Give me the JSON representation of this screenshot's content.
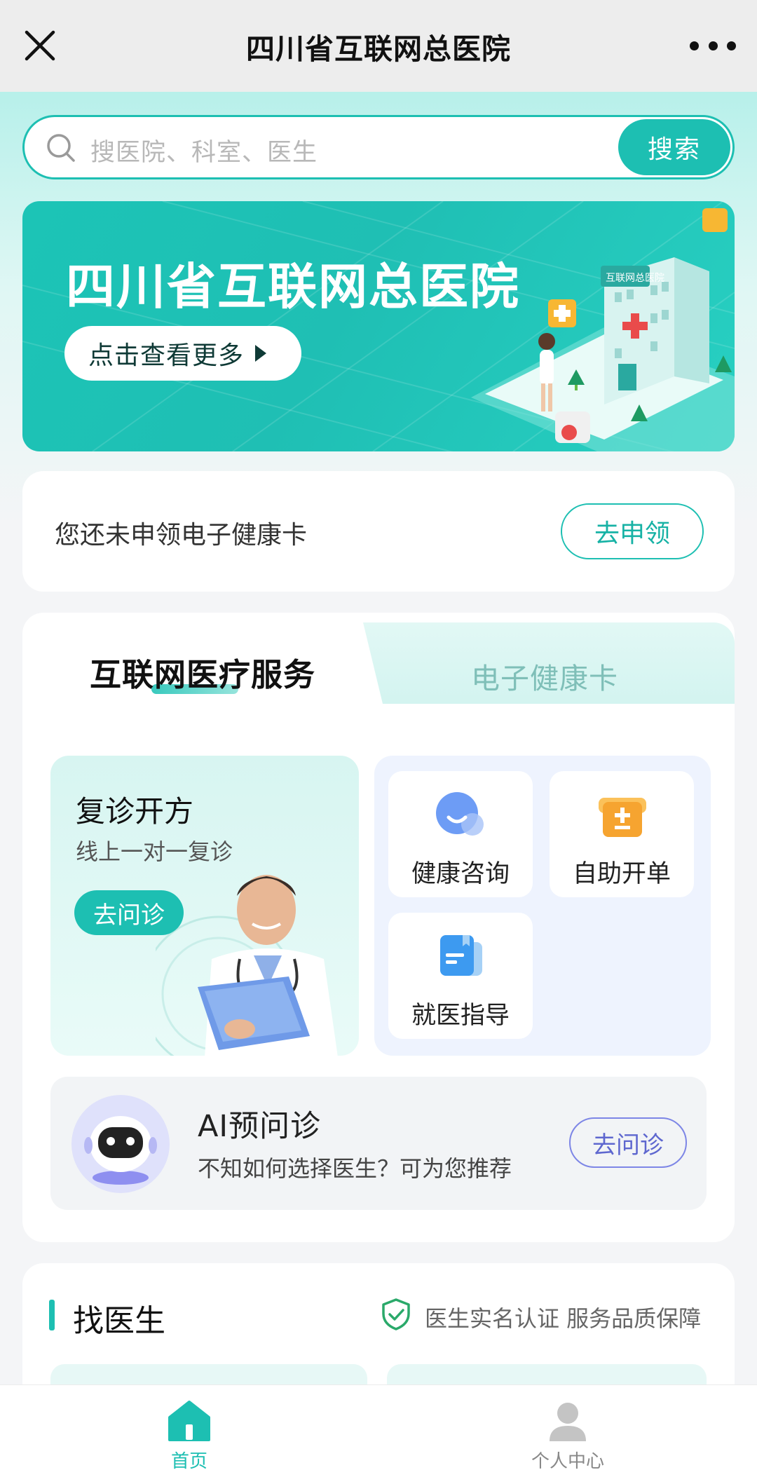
{
  "header": {
    "title": "四川省互联网总医院",
    "close_icon": "close-icon",
    "more_icon": "more-dots-icon"
  },
  "search": {
    "placeholder": "搜医院、科室、医生",
    "button": "搜索"
  },
  "banner": {
    "title": "四川省互联网总医院",
    "button": "点击查看更多"
  },
  "health_card": {
    "text": "您还未申领电子健康卡",
    "button": "去申领"
  },
  "tabs": {
    "active": "互联网医疗服务",
    "inactive": "电子健康卡"
  },
  "followup": {
    "title": "复诊开方",
    "subtitle": "线上一对一复诊",
    "button": "去问诊"
  },
  "quick_items": [
    {
      "label": "健康咨询",
      "icon": "chat-bubble-icon"
    },
    {
      "label": "自助开单",
      "icon": "order-box-icon"
    },
    {
      "label": "就医指导",
      "icon": "guide-doc-icon"
    }
  ],
  "ai": {
    "title": "AI预问诊",
    "subtitle": "不知如何选择医生？可为您推荐",
    "button": "去问诊"
  },
  "find_doctor": {
    "title": "找医生",
    "note": "医生实名认证 服务品质保障"
  },
  "tabbar": {
    "home": "首页",
    "me": "个人中心"
  },
  "colors": {
    "accent": "#1dbfb2",
    "ai_purple": "#7d86e6"
  }
}
